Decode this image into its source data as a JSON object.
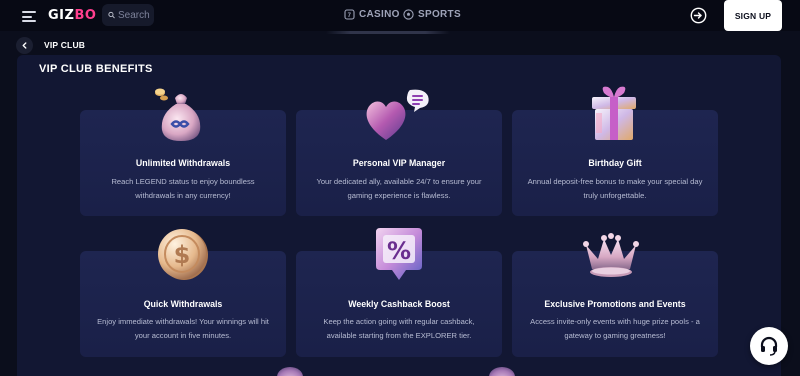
{
  "header": {
    "logo_prefix": "GIZ",
    "logo_suffix": "BO",
    "search_placeholder": "Search",
    "tabs": [
      {
        "label": "CASINO",
        "icon": "casino-icon"
      },
      {
        "label": "SPORTS",
        "icon": "soccer-ball-icon"
      }
    ],
    "signup_label": "SIGN UP"
  },
  "breadcrumb": {
    "title": "VIP CLUB"
  },
  "benefits": {
    "title": "VIP CLUB BENEFITS",
    "cards": [
      {
        "title": "Unlimited Withdrawals",
        "description": "Reach LEGEND status to enjoy boundless withdrawals in any currency!",
        "icon": "money-bag-icon"
      },
      {
        "title": "Personal VIP Manager",
        "description": "Your dedicated ally, available 24/7 to ensure your gaming experience is flawless.",
        "icon": "heart-chat-icon"
      },
      {
        "title": "Birthday Gift",
        "description": "Annual deposit-free bonus to make your special day truly unforgettable.",
        "icon": "gift-box-icon"
      },
      {
        "title": "Quick Withdrawals",
        "description": "Enjoy immediate withdrawals! Your winnings will hit your account in five minutes.",
        "icon": "dollar-coin-icon"
      },
      {
        "title": "Weekly Cashback Boost",
        "description": "Keep the action going with regular cashback, available starting from the EXPLORER tier.",
        "icon": "percent-tag-icon"
      },
      {
        "title": "Exclusive Promotions and Events",
        "description": "Access invite-only events with huge prize pools - a gateway to gaming greatness!",
        "icon": "crown-icon"
      }
    ]
  },
  "colors": {
    "background": "#0b0e1c",
    "header": "#070914",
    "panel": "#121733",
    "card": "#1e2550",
    "logo_accent": "#ff3f8e"
  }
}
